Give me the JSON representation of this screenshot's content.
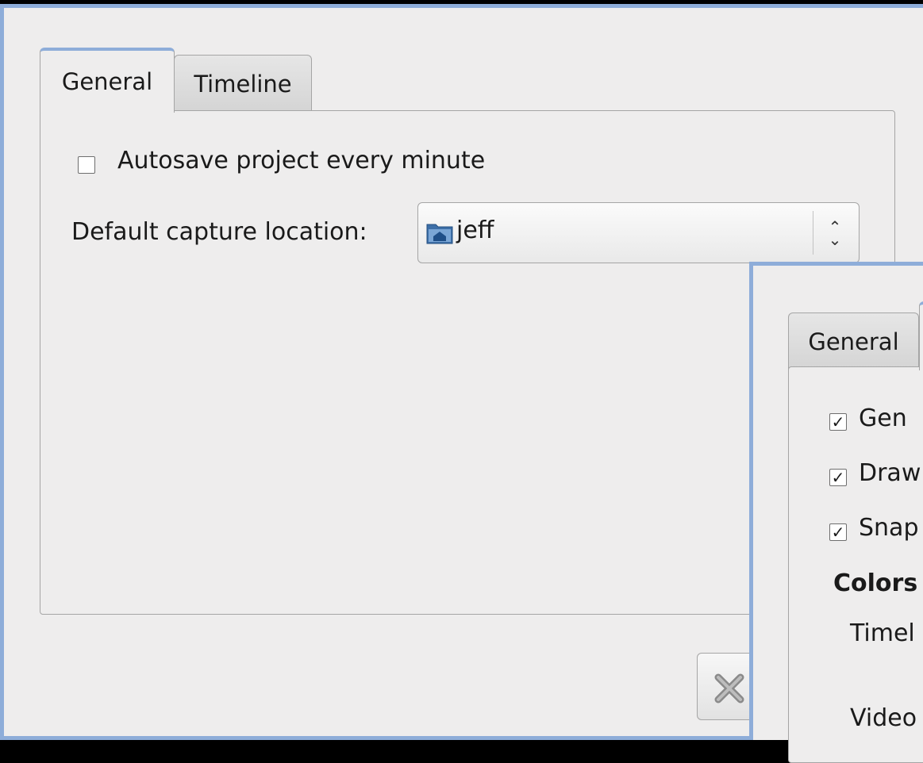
{
  "back_window": {
    "tabs": [
      {
        "label": "General",
        "active": true
      },
      {
        "label": "Timeline",
        "active": false
      }
    ],
    "autosave": {
      "label": "Autosave project every minute",
      "checked": false
    },
    "capture": {
      "label": "Default capture location:",
      "value": "jeff",
      "icon": "home-folder-icon"
    },
    "button_icon": "close-icon"
  },
  "front_window": {
    "tabs": [
      {
        "label": "General",
        "active": false
      }
    ],
    "options": [
      {
        "label": "Gen",
        "checked": true
      },
      {
        "label": "Draw",
        "checked": true
      },
      {
        "label": "Snap",
        "checked": true
      }
    ],
    "section_title": "Colors",
    "rows": [
      "Timel",
      "Video"
    ]
  },
  "colors": {
    "window_border": "#8eadd9",
    "window_bg": "#eeeded",
    "backdrop": "#000000"
  }
}
